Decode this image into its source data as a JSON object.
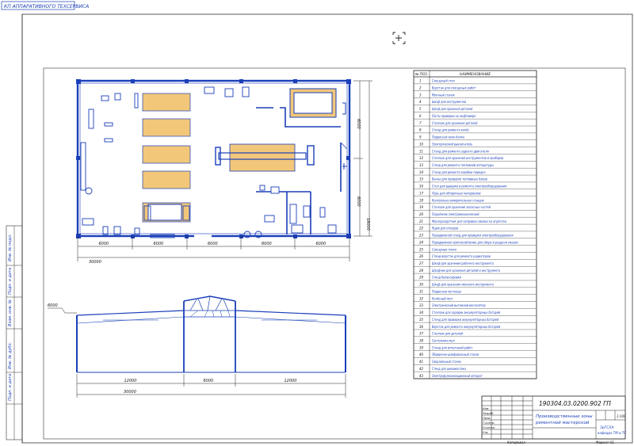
{
  "corner_label": "КП АППАРАТИВНОГО ТЕХСЕРВИСА",
  "window_icon": "crosshair-plus-icon",
  "colors": {
    "line": "#1a3fb8",
    "paper": "#ffffff",
    "frame": "#333333",
    "fill": "#f2c77a"
  },
  "plan": {
    "dim_segments": [
      "6000",
      "6000",
      "6000",
      "6000",
      "6000"
    ],
    "dim_total": "30000",
    "dim_right": [
      "6000",
      "6000"
    ],
    "dim_right_total": "18000"
  },
  "section": {
    "height_label": "6000",
    "dims": [
      "12000",
      "6000",
      "12000"
    ],
    "total": "30000"
  },
  "table": {
    "header_num": "№ ПОЗ.",
    "header_name": "НАИМЕНОВАНИЕ",
    "rows": [
      {
        "n": "1",
        "name": "Слесарный стол"
      },
      {
        "n": "2",
        "name": "Верстак для слесарных работ"
      },
      {
        "n": "3",
        "name": "Моечный станок"
      },
      {
        "n": "4",
        "name": "Шкаф для инструментов"
      },
      {
        "n": "5",
        "name": "Шкаф для хранения деталей"
      },
      {
        "n": "6",
        "name": "Посты проверки на люфтомере"
      },
      {
        "n": "7",
        "name": "Стеллаж для хранения деталей"
      },
      {
        "n": "8",
        "name": "Стенд для ремонта колёс"
      },
      {
        "n": "9",
        "name": "Подвесная кран-балка"
      },
      {
        "n": "10",
        "name": "Электрический выключатель"
      },
      {
        "n": "11",
        "name": "Стенд для ремонта заднего двигателя"
      },
      {
        "n": "12",
        "name": "Стеллаж для хранения инструментов и приборов"
      },
      {
        "n": "13",
        "name": "Стенд для ремонта топливной аппаратуры"
      },
      {
        "n": "14",
        "name": "Стенд для ремонта коробки передач"
      },
      {
        "n": "15",
        "name": "Ванна для проверки топливных баков"
      },
      {
        "n": "16",
        "name": "Стол для выверки и ремонта электрооборудования"
      },
      {
        "n": "17",
        "name": "Ларь для обтирочных материалов"
      },
      {
        "n": "18",
        "name": "Контрольно-измерительная станция"
      },
      {
        "n": "19",
        "name": "Стеллаж для хранения запасных частей"
      },
      {
        "n": "20",
        "name": "Подъёмник электромеханический"
      },
      {
        "n": "21",
        "name": "Маслораздатчик для заправки смазки на агрегаты"
      },
      {
        "n": "22",
        "name": "Ящик для отходов"
      },
      {
        "n": "23",
        "name": "Передвижной стенд для проверки электрооборудования"
      },
      {
        "n": "24",
        "name": "Передвижное приспособление для сбора и раздачи смазки"
      },
      {
        "n": "25",
        "name": "Слесарные тиски"
      },
      {
        "n": "26",
        "name": "Стенд-верстак для ремонта радиаторов"
      },
      {
        "n": "27",
        "name": "Шкаф для хранения рабочего инструмента"
      },
      {
        "n": "28",
        "name": "Шкафчик для хранения деталей и инструмента"
      },
      {
        "n": "29",
        "name": "Стенд балансировки"
      },
      {
        "n": "30",
        "name": "Шкаф для хранения сменного инструмента"
      },
      {
        "n": "31",
        "name": "Подвесная лестница"
      },
      {
        "n": "32",
        "name": "Колёсный пост"
      },
      {
        "n": "33",
        "name": "Электрический вытяжной вентилятор"
      },
      {
        "n": "34",
        "name": "Стеллаж для зарядки аккумуляторных батарей"
      },
      {
        "n": "35",
        "name": "Стенд для проверки аккумуляторных батарей"
      },
      {
        "n": "36",
        "name": "Верстак для ремонта аккумуляторных батарей"
      },
      {
        "n": "37",
        "name": "Стеллаж для деталей"
      },
      {
        "n": "38",
        "name": "Сантехника мыл"
      },
      {
        "n": "39",
        "name": "Стенд для испытаний работ"
      },
      {
        "n": "40",
        "name": "Обдирочно-шлифовальный станок"
      },
      {
        "n": "41",
        "name": "Сверлильный станок"
      },
      {
        "n": "42",
        "name": "Стенд для шиномонтажа"
      },
      {
        "n": "43",
        "name": "Электровулканизационный аппарат"
      }
    ]
  },
  "title_block": {
    "doc_code": "190304.03.0200.902 ГП",
    "title_line1": "Производственные зоны",
    "title_line2": "ремонтной мастерской",
    "scale": "1:100",
    "org_line1": "ЗрГСХА",
    "org_line2": "кафедра ТМ и ТС",
    "roles": [
      "Изм.",
      "Разраб.",
      "Пров.",
      "Т.контр.",
      "Н.контр.",
      "Утв."
    ],
    "copied": "Копировал",
    "format": "Формат А1"
  },
  "side_stamp_labels": [
    "Инв. № подл.",
    "Подп. и дата",
    "Взам. инв. №",
    "Инв. № дубл.",
    "Подп. и дата"
  ]
}
